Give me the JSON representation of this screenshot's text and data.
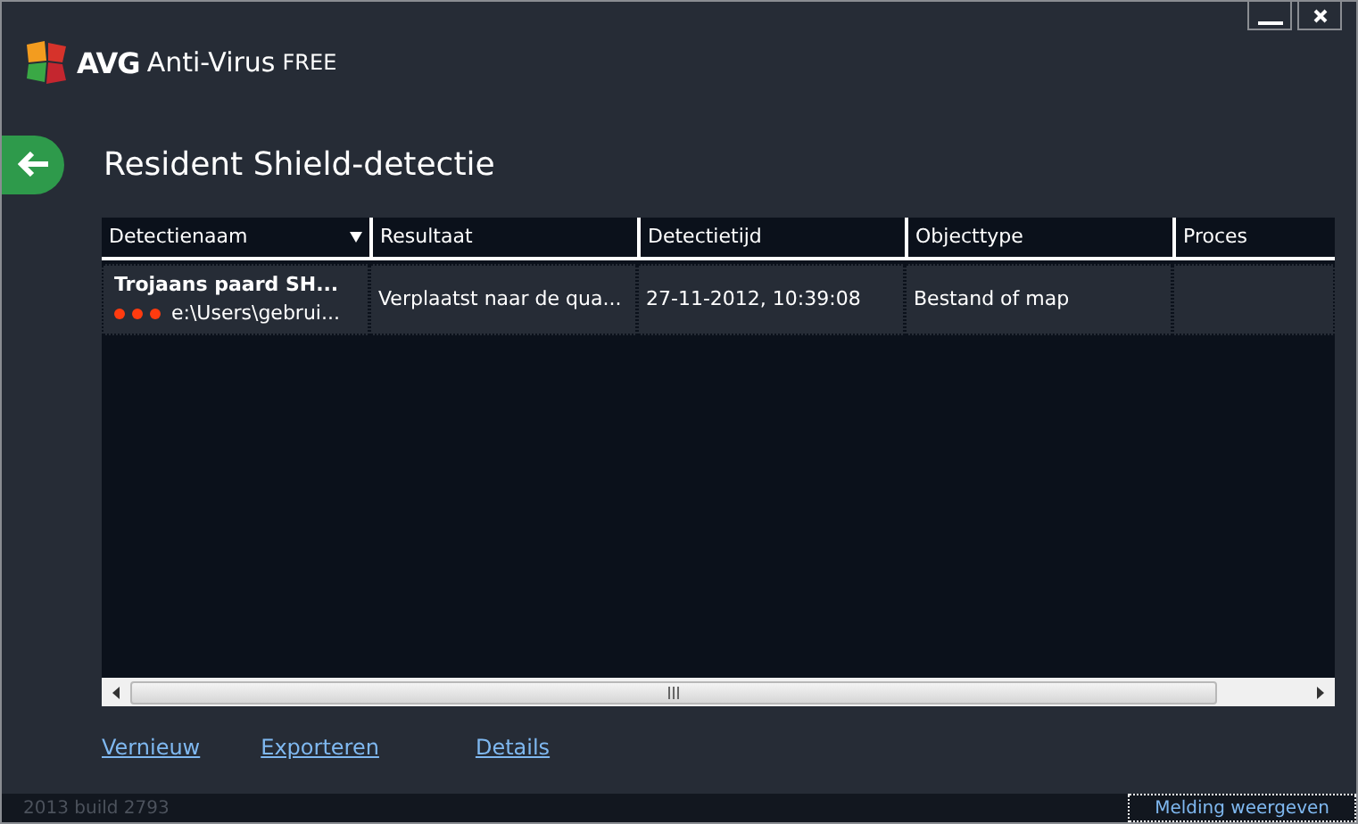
{
  "app": {
    "brand": "AVG",
    "product": "Anti-Virus",
    "edition": "FREE"
  },
  "page_title": "Resident Shield-detectie",
  "table": {
    "columns": [
      {
        "label": "Detectienaam",
        "sorted": true
      },
      {
        "label": "Resultaat",
        "sorted": false
      },
      {
        "label": "Detectietijd",
        "sorted": false
      },
      {
        "label": "Objecttype",
        "sorted": false
      },
      {
        "label": "Proces",
        "sorted": false
      }
    ],
    "rows": [
      {
        "name": "Trojaans paard SH...",
        "path": "e:\\Users\\gebrui...",
        "result": "Verplaatst naar de qua...",
        "time": "27-11-2012, 10:39:08",
        "object_type": "Bestand of map"
      }
    ]
  },
  "links": [
    "Vernieuw",
    "Exporteren",
    "Details"
  ],
  "status_bar": {
    "build": "2013  build 2793",
    "button": "Melding weergeven"
  }
}
